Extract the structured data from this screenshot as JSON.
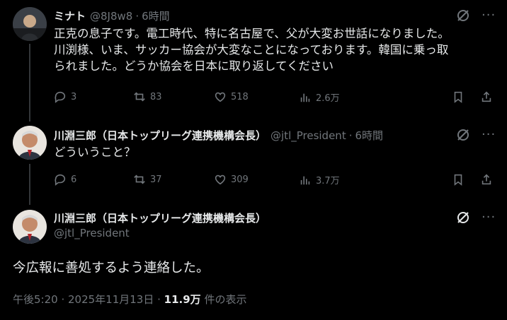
{
  "posts": [
    {
      "name": "ミナト",
      "handle": "@8J8w8",
      "sep": "·",
      "time": "6時間",
      "text_lines": [
        "正克の息子です。電工時代、特に名古屋で、父が大変お世話になりました。",
        "川渕様、いま、サッカー協会が大変なことになっております。韓国に乗っ取",
        "られました。どうか協会を日本に取り返してください"
      ],
      "stats": {
        "replies": "3",
        "reposts": "83",
        "likes": "518",
        "views": "2.6万"
      }
    },
    {
      "name": "川淵三郎（日本トップリーグ連携機構会長）",
      "handle": "@jtl_President",
      "sep": "·",
      "time": "6時間",
      "text": "どういうこと？",
      "stats": {
        "replies": "6",
        "reposts": "37",
        "likes": "309",
        "views": "3.7万"
      }
    }
  ],
  "main_post": {
    "name": "川淵三郎（日本トップリーグ連携機構会長）",
    "handle": "@jtl_President",
    "text": "今広報に善処するよう連絡した。",
    "footer_date": "午後5:20 · 2025年11月13日 · ",
    "footer_views": "11.9万",
    "footer_views_label": " 件の表示"
  },
  "icons": [
    "grok-icon",
    "more-icon",
    "reply-icon",
    "repost-icon",
    "like-icon",
    "views-icon",
    "bookmark-icon",
    "share-icon"
  ]
}
